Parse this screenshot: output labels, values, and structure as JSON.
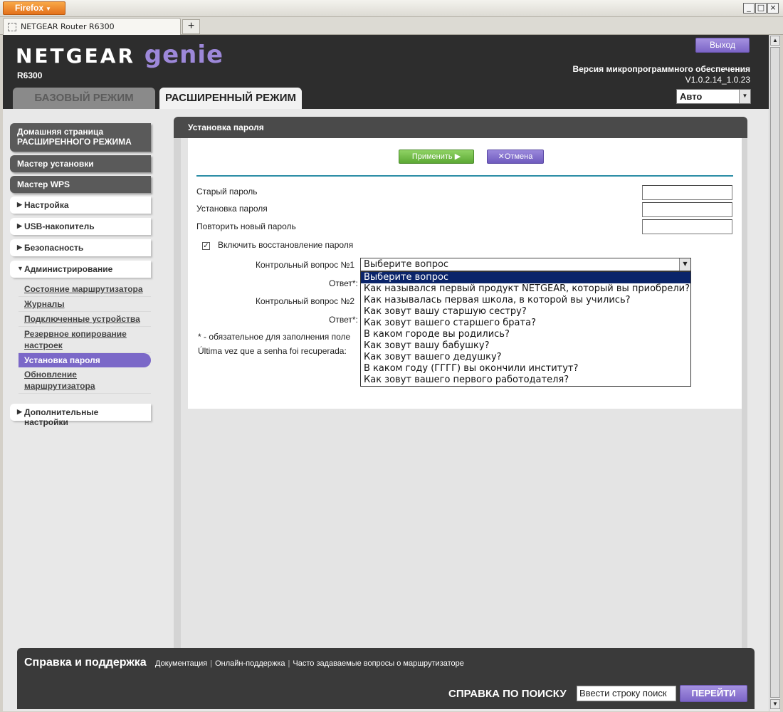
{
  "browser": {
    "app_button": "Firefox",
    "tab_title": "NETGEAR Router R6300",
    "new_tab": "+"
  },
  "header": {
    "brand": "NETGEAR",
    "brand_suffix": "genie",
    "model": "R6300",
    "logout": "Выход",
    "firmware_label": "Версия микропрограммного обеспечения",
    "firmware_version": "V1.0.2.14_1.0.23",
    "language": "Авто",
    "tab_basic": "БАЗОВЫЙ РЕЖИМ",
    "tab_advanced": "РАСШИРЕННЫЙ РЕЖИМ"
  },
  "nav": {
    "home": "Домашняя страница РАСШИРЕННОГО РЕЖИМА",
    "setup_wizard": "Мастер установки",
    "wps_wizard": "Мастер WPS",
    "settings": "Настройка",
    "usb": "USB-накопитель",
    "security": "Безопасность",
    "admin": "Администрирование",
    "admin_items": [
      {
        "label": "Состояние маршрутизатора"
      },
      {
        "label": "Журналы"
      },
      {
        "label": "Подключенные устройства"
      },
      {
        "label": "Резервное копирование настроек"
      },
      {
        "label": "Установка пароля"
      },
      {
        "label": "Обновление маршрутизатора"
      }
    ],
    "advanced_settings": "Дополнительные настройки"
  },
  "content": {
    "title": "Установка пароля",
    "apply": "Применить",
    "cancel": "Отмена",
    "old_password": "Старый пароль",
    "new_password": "Установка пароля",
    "repeat_password": "Повторить новый пароль",
    "enable_recovery": "Включить восстановление пароля",
    "question1": "Контрольный вопрос №1",
    "answer1": "Ответ*:",
    "question2": "Контрольный вопрос №2",
    "answer2": "Ответ*:",
    "required_note": "* - обязательное для заполнения поле",
    "last_recovered": "Última vez que a senha foi recuperada:",
    "selected_question": "Выберите вопрос",
    "question_options": [
      "Выберите вопрос",
      "Как назывался первый продукт NETGEAR, который вы приобрели?",
      "Как называлась первая школа, в которой вы учились?",
      "Как зовут вашу старшую сестру?",
      "Как зовут вашего старшего брата?",
      "В каком городе вы родились?",
      "Как зовут вашу бабушку?",
      "Как зовут вашего дедушку?",
      "В каком году (ГГГГ) вы окончили институт?",
      "Как зовут вашего первого работодателя?"
    ]
  },
  "footer": {
    "title": "Справка и поддержка",
    "links": [
      "Документация",
      "Онлайн-поддержка",
      "Часто задаваемые вопросы о маршрутизаторе"
    ],
    "search_label": "СПРАВКА ПО ПОИСКУ",
    "search_value": "Ввести строку поиск",
    "search_button": "ПЕРЕЙТИ"
  },
  "colors": {
    "accent_purple": "#7b68c8",
    "apply_green": "#5ca934",
    "header_dark": "#2d2d2d",
    "rule_teal": "#2c8ea6"
  }
}
